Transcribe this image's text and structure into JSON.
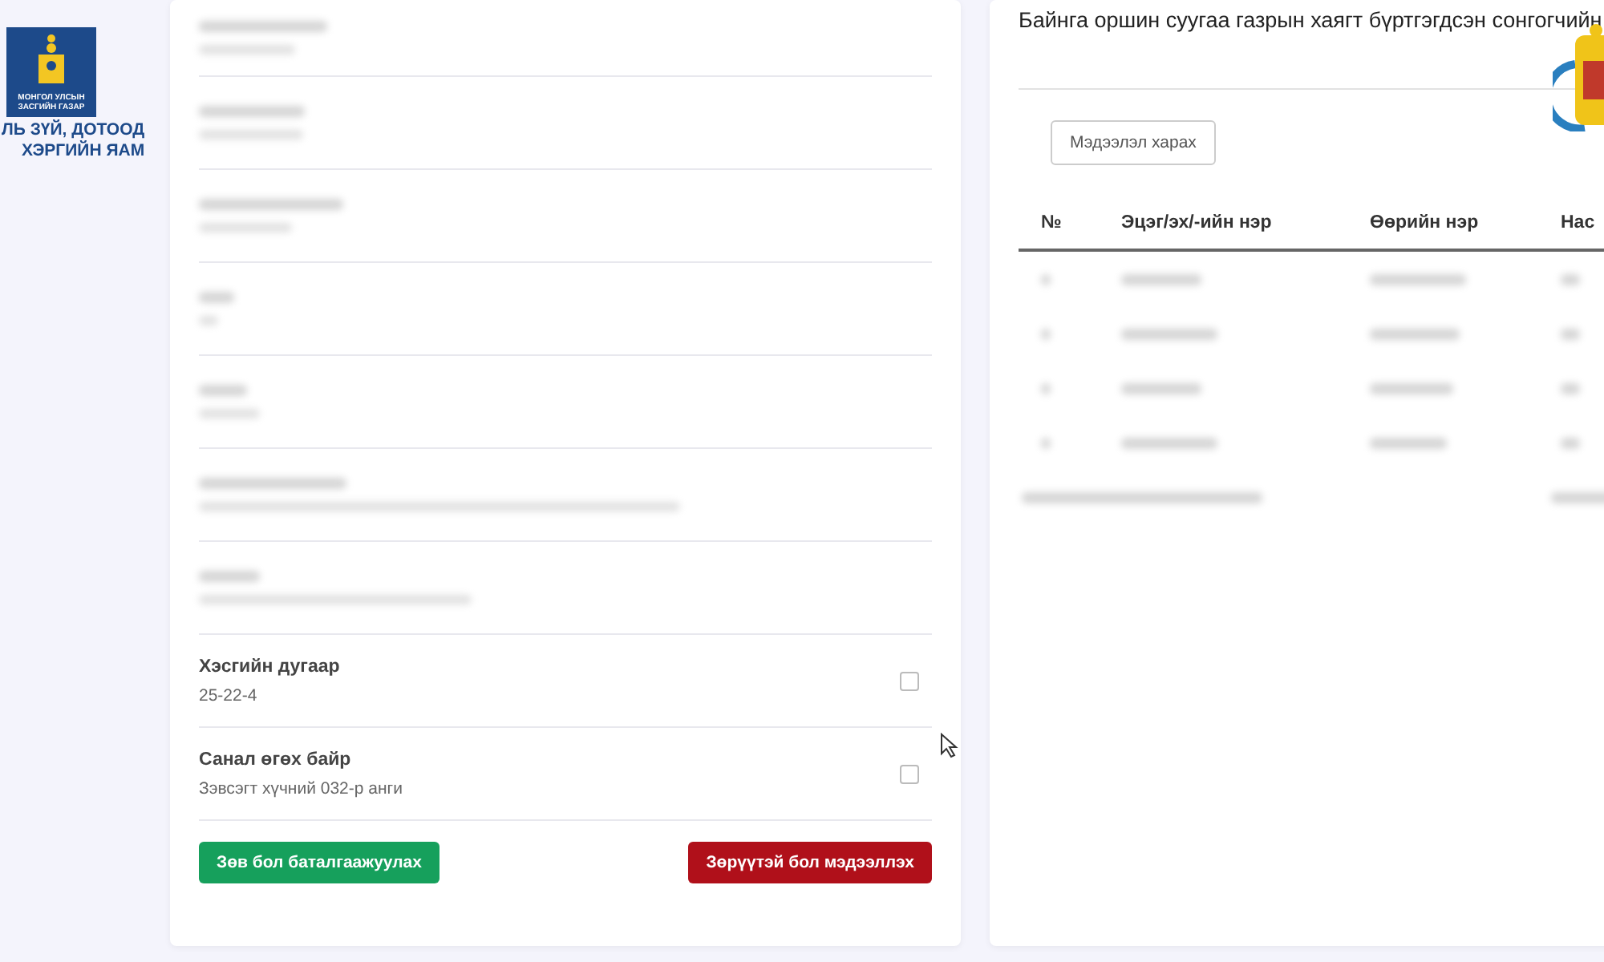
{
  "ministry_logo": {
    "badge_lines": [
      "МОНГОЛ УЛСЫН",
      "ЗАСГИЙН ГАЗАР"
    ],
    "name_lines": [
      "ЛЬ ЗҮЙ, ДОТООД",
      "ХЭРГИЙН ЯАМ"
    ]
  },
  "voter_card": {
    "fields": [
      {
        "kind": "blurred"
      },
      {
        "kind": "blurred"
      },
      {
        "kind": "blurred"
      },
      {
        "kind": "blurred"
      },
      {
        "kind": "blurred"
      },
      {
        "kind": "blurred"
      },
      {
        "kind": "blurred"
      },
      {
        "kind": "text",
        "label": "Хэсгийн дугаар",
        "value": "25-22-4",
        "checked": false
      },
      {
        "kind": "text",
        "label": "Санал өгөх байр",
        "value": "Зэвсэгт хүчний 032-р анги",
        "checked": false
      }
    ],
    "buttons": [
      {
        "kind": "confirm",
        "label": "Зөв бол баталгаажуулах"
      },
      {
        "kind": "report",
        "label": "Зөрүүтэй бол мэдээллэх"
      }
    ]
  },
  "household_panel": {
    "title": "Байнга оршин суугаа газрын хаягт бүртгэгдсэн сонгогчийн",
    "view_button": "Мэдээлэл харах",
    "table": {
      "columns": [
        "№",
        "Эцэг/эх/-ийн нэр",
        "Өөрийн нэр",
        "Нас"
      ],
      "rows": [
        {
          "kind": "blurred"
        },
        {
          "kind": "blurred"
        },
        {
          "kind": "blurred"
        },
        {
          "kind": "blurred"
        }
      ],
      "footer": {
        "kind": "blurred"
      }
    }
  }
}
